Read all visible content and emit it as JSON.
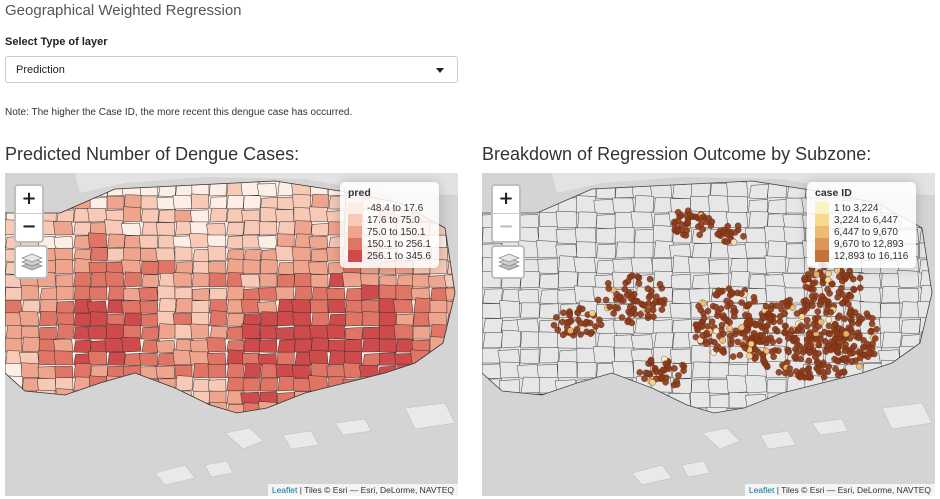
{
  "app": {
    "title": "Geographical Weighted Regression"
  },
  "layer_select": {
    "label": "Select Type of layer",
    "value": "Prediction"
  },
  "note": "Note: The higher the Case ID, the more recent this dengue case has occurred.",
  "left_map": {
    "heading": "Predicted Number of Dengue Cases:",
    "zoom_in": "+",
    "zoom_out": "−",
    "legend": {
      "title": "pred",
      "items": [
        {
          "label": "-48.4 to 17.6",
          "color": "#fdeee6"
        },
        {
          "label": "17.6 to 75.0",
          "color": "#f7c9b6"
        },
        {
          "label": "75.0 to 150.1",
          "color": "#eea48d"
        },
        {
          "label": "150.1 to 256.1",
          "color": "#e17565"
        },
        {
          "label": "256.1 to 345.6",
          "color": "#cf4b4b"
        }
      ]
    },
    "attribution": {
      "link": "Leaflet",
      "text": " | Tiles © Esri — Esri, DeLorme, NAVTEQ"
    }
  },
  "right_map": {
    "heading": "Breakdown of Regression Outcome by Subzone:",
    "zoom_in": "+",
    "zoom_out": "−",
    "legend": {
      "title": "case ID",
      "items": [
        {
          "label": "1 to 3,224",
          "color": "#fdf2c4"
        },
        {
          "label": "3,224 to 6,447",
          "color": "#f7d98f"
        },
        {
          "label": "6,447 to 9,670",
          "color": "#eebc70"
        },
        {
          "label": "9,670 to 12,893",
          "color": "#dd9659"
        },
        {
          "label": "12,893 to 16,116",
          "color": "#c5713e"
        }
      ]
    },
    "attribution": {
      "link": "Leaflet",
      "text": " | Tiles © Esri — Esri, DeLorme, NAVTEQ"
    }
  },
  "colors": {
    "sea": "#d4d4d4",
    "land": "#ebebeb",
    "boundary": "#333333",
    "dengue_point": "#8b3a1a"
  }
}
